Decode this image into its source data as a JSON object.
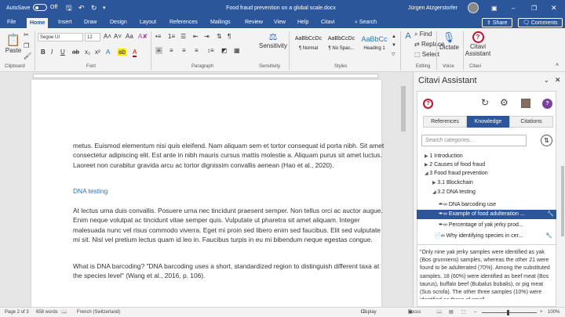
{
  "titlebar": {
    "autosave_label": "AutoSave",
    "autosave_state": "Off",
    "doc_title": "Food fraud prevention on a global scale.docx",
    "user": "Jürgen Atzgerstorfer",
    "accent": "#2b579a"
  },
  "tabs": [
    "File",
    "Home",
    "Insert",
    "Draw",
    "Design",
    "Layout",
    "References",
    "Mailings",
    "Review",
    "View",
    "Help",
    "Citavi"
  ],
  "search_label": "Search",
  "share_label": "Share",
  "comments_label": "Comments",
  "ribbon": {
    "paste": "Paste",
    "clipboard": "Clipboard",
    "font_name": "Segoe UI",
    "font_size": "12",
    "font": "Font",
    "paragraph": "Paragraph",
    "styles_group": "Styles",
    "styles": [
      {
        "preview": "AaBbCcDc",
        "name": "¶ Normal"
      },
      {
        "preview": "AaBbCcDc",
        "name": "¶ No Spac..."
      },
      {
        "preview": "AaBbCc",
        "name": "Heading 1"
      }
    ],
    "sensitivity": "Sensitivity",
    "sensitivity_group": "Sensitivity",
    "styles_btn": "Styles",
    "find": "Find",
    "replace": "Replace",
    "select": "Select",
    "editing": "Editing",
    "dictate": "Dictate",
    "voice": "Voice",
    "citavi_assistant": [
      "Citavi",
      "Assistant"
    ],
    "citavi_group": "Citavi"
  },
  "document": {
    "p1": "metus. Euismod elementum nisi quis eleifend. Nam aliquam sem et tortor consequat id porta nibh. Sit amet consectetur adipiscing elit. Est ante in nibh mauris cursus mattis molestie a. Aliquam purus sit amet luctus. Laoreet non curabitur gravida arcu ac tortor dignissim convallis aenean (Hao et al., 2020).",
    "heading": "DNA testing",
    "p2": "At lectus urna duis convallis. Posuere urna nec tincidunt praesent semper. Non tellus orci ac auctor augue. Enim neque volutpat ac tincidunt vitae semper quis. Vulputate ut pharetra sit amet aliquam. Integer malesuada nunc vel risus commodo viverra. Eget mi proin sed libero enim sed faucibus. Elit sed vulputate mi sit. Nisl vel pretium lectus quam id leo in. Faucibus turpis in eu mi bibendum neque egestas congue.",
    "p3": "What is DNA barcoding? \"DNA barcoding uses a short, standardized region to distinguish different taxa at the species level\" (Wang et al., 2016, p. 106)."
  },
  "statusbar": {
    "page": "Page 2 of 3",
    "words": "658 words",
    "language": "French (Switzerland)",
    "display_settings": "Display Settings",
    "focus": "Focus",
    "zoom": "100%"
  },
  "panel": {
    "title": "Citavi Assistant",
    "tabs": [
      "References",
      "Knowledge",
      "Citations"
    ],
    "active_tab": "Knowledge",
    "search_placeholder": "Search categories...",
    "tree": [
      "1 Introduction",
      "2 Causes of food fraud",
      "3 Food fraud prevention",
      "3.1 Blockchain",
      "3.2 DNA testing",
      "DNA barcoding use",
      "Example of food adulteration ...",
      "Percentage of yak jerky prod...",
      "Why identifying species in cer..."
    ],
    "quote": "\"Only nine yak jerky samples were identified as yak (Bos grunniens) samples, whereas the other 21 were found to be adulterated (70%). Among the substituted samples, 18 (60%) were identified as beef meat (Bos taurus), buffalo beef (Bubalus bubalis), or pig meat (Sus scrofa). The other three samples (10%) were identified as those of small",
    "help": "?"
  }
}
